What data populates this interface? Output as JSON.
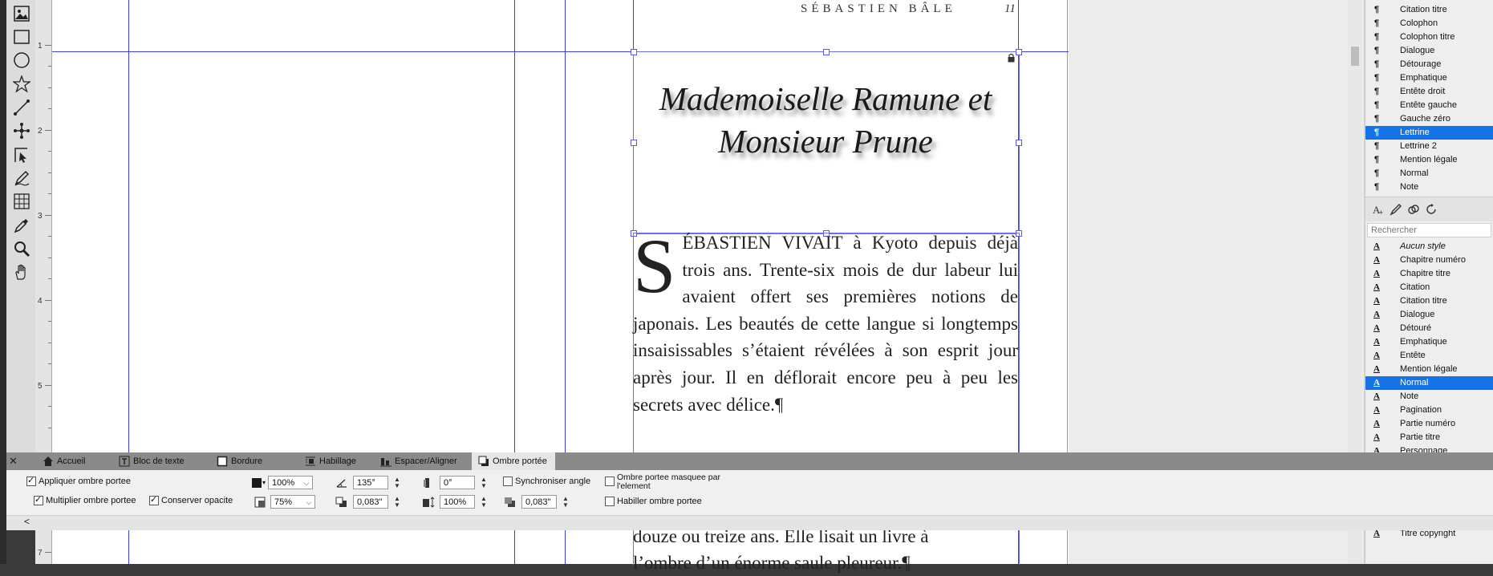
{
  "page": {
    "running_head": "SÉBASTIEN BÂLE",
    "folio": "11",
    "title_lines": [
      "Mademoiselle Ramune et",
      "Monsieur Prune"
    ],
    "dropcap": "S",
    "paragraph_1": "ÉBASTIEN VIVAIT à Kyoto depuis déjà trois ans. Trente-six mois de dur labeur lui avaient offert ses premières notions de japonais. Les beautés de cette langue si longtemps insaisissables s’étaient révélées à son esprit jour après jour. Il en déflorait encore peu à peu les secrets avec délice.¶",
    "paragraph_2_line_1": "douze ou treize ans. Elle lisait un livre à",
    "paragraph_2_line_2": "l’ombre d’un énorme saule pleureur.¶"
  },
  "ruler": {
    "numbers": [
      "1",
      "2",
      "3",
      "4",
      "5",
      "7"
    ]
  },
  "tools": [
    {
      "name": "image-frame-tool-icon"
    },
    {
      "name": "rectangle-tool-icon"
    },
    {
      "name": "ellipse-tool-icon"
    },
    {
      "name": "star-tool-icon"
    },
    {
      "name": "line-tool-icon"
    },
    {
      "name": "pen-tool-icon"
    },
    {
      "name": "direct-selection-tool-icon"
    },
    {
      "name": "pencil-tool-icon"
    },
    {
      "name": "table-tool-icon"
    },
    {
      "name": "eyedropper-tool-icon"
    },
    {
      "name": "zoom-tool-icon"
    },
    {
      "name": "hand-tool-icon"
    }
  ],
  "paragraph_styles": {
    "items": [
      "Citation titre",
      "Colophon",
      "Colophon titre",
      "Dialogue",
      "Détourage",
      "Emphatique",
      "Entête droit",
      "Entête gauche",
      "Gauche zéro",
      "Lettrine",
      "Lettrine 2",
      "Mention légale",
      "Normal",
      "Note"
    ],
    "glyph": "¶",
    "selected": "Lettrine"
  },
  "character_styles": {
    "search_placeholder": "Rechercher",
    "items": [
      "Aucun style",
      "Chapitre numéro",
      "Chapitre titre",
      "Citation",
      "Citation titre",
      "Dialogue",
      "Détouré",
      "Emphatique",
      "Entête",
      "Mention légale",
      "Normal",
      "Note",
      "Pagination",
      "Partie numéro",
      "Partie titre",
      "Personnage"
    ],
    "glyph": "A",
    "selected": "Normal",
    "last_item": "Titre copyright"
  },
  "bottom_tabs": {
    "close_glyph": "✕",
    "items": [
      "Accueil",
      "Bloc de texte",
      "Bordure",
      "Habillage",
      "Espacer/Aligner",
      "Ombre portée"
    ],
    "active": "Ombre portée"
  },
  "shadow_options": {
    "apply_label": "Appliquer ombre portee",
    "apply_checked": true,
    "multiply_label": "Multiplier ombre portee",
    "multiply_checked": true,
    "keep_opacity_label": "Conserver opacite",
    "keep_opacity_checked": true,
    "color": "#1a1a1a",
    "shade": "100%",
    "opacity": "75%",
    "angle": "135°",
    "distance": "0,083\"",
    "skew": "0°",
    "scale": "100%",
    "blur": "0,083\"",
    "sync_angle_label": "Synchroniser angle",
    "sync_angle_checked": false,
    "masked_label_1": "Ombre portee masquee par",
    "masked_label_2": "l'element",
    "masked_checked": false,
    "wrap_label": "Habiller ombre portee",
    "wrap_checked": false,
    "collapse_glyph": "<"
  },
  "colors": {
    "guide": "#3d3df0",
    "selection": "#1473e6"
  }
}
